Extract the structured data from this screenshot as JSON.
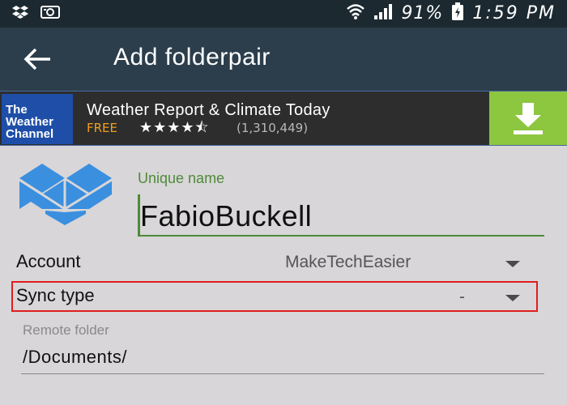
{
  "status_bar": {
    "battery": "91%",
    "time": "1:59 PM",
    "left_icons": [
      "dropbox-icon",
      "screenshot-icon"
    ],
    "right_icons": [
      "wifi-icon",
      "signal-icon",
      "battery-icon"
    ]
  },
  "app_bar": {
    "back_icon": "arrow-left-icon",
    "title": "Add folderpair",
    "background": "#2c3e4c"
  },
  "ad": {
    "logo_lines": [
      "The",
      "Weather",
      "Channel"
    ],
    "title": "Weather Report & Climate Today",
    "price": "FREE",
    "stars": "★★★★⯪",
    "review_count": "(1,310,449)",
    "download_icon": "download-icon",
    "button_color": "#8dc63f"
  },
  "form": {
    "logo_icon": "dropbox-icon",
    "unique_name": {
      "label": "Unique name",
      "value": "FabioBuckell"
    },
    "account": {
      "label": "Account",
      "value": "MakeTechEasier"
    },
    "sync_type": {
      "label": "Sync type",
      "value": "-",
      "highlight_color": "#e01e1e"
    },
    "remote_folder": {
      "label": "Remote folder",
      "value": "/Documents/"
    },
    "accent_color": "#4f8a3a"
  }
}
